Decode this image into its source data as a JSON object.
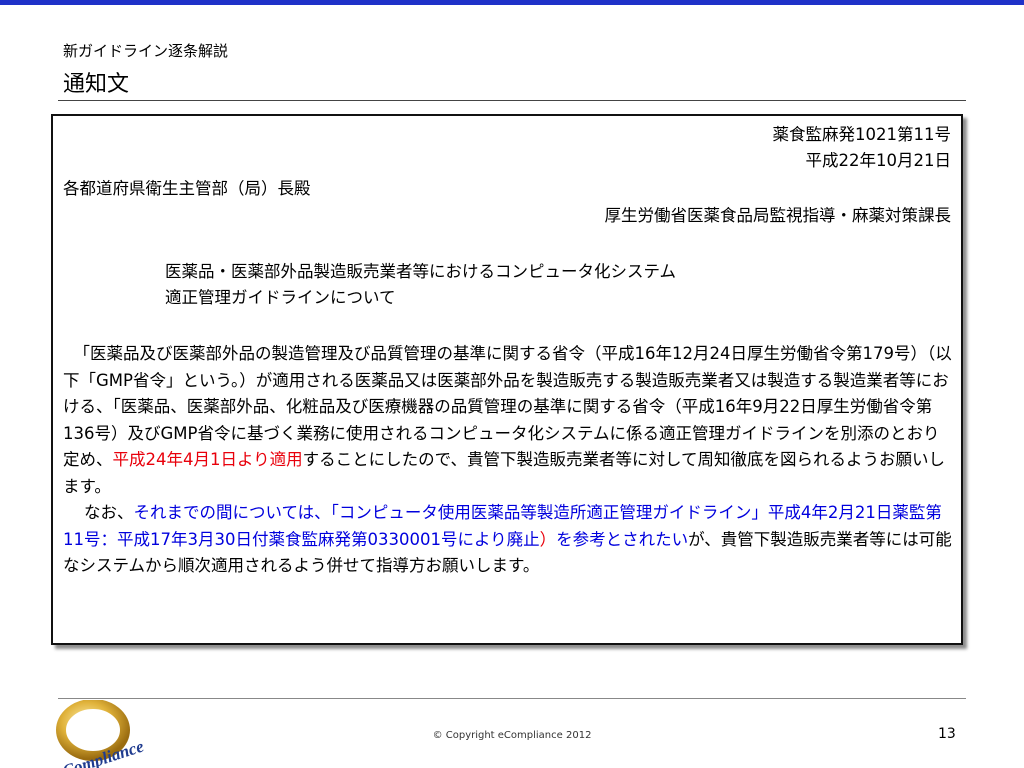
{
  "header": {
    "subtitle": "新ガイドライン逐条解説",
    "title": "通知文"
  },
  "document": {
    "doc_number": "薬食監麻発1021第11号",
    "date": "平成22年10月21日",
    "addressee": "各都道府県衛生主管部（局）長殿",
    "sender": "厚生労働省医薬食品局監視指導・麻薬対策課長",
    "subject_line1": "医薬品・医薬部外品製造販売業者等におけるコンピュータ化システム",
    "subject_line2": "適正管理ガイドラインについて",
    "body1_a": "「医薬品及び医薬部外品の製造管理及び品質管理の基準に関する省令（平成16年12月24日厚生労働省令第179号）（以下「GMP省令」という。）が適用される医薬品又は医薬部外品を製造販売する製造販売業者又は製造する製造業者等における、「医薬品、医薬部外品、化粧品及び医療機器の品質管理の基準に関する省令（平成16年9月22日厚生労働省令第136号）及びGMP省令に基づく業務に使用されるコンピュータ化システムに係る適正管理ガイドラインを別添のとおり定め、",
    "body1_red": "平成24年4月1日より適用",
    "body1_b": "することにしたので、貴管下製造販売業者等に対して周知徹底を図られるようお願いします。",
    "body2_a": "なお、",
    "body2_blue": "それまでの間については、「コンピュータ使用医薬品等製造所適正管理ガイドライン」平成4年2月21日薬監第11号：平成17年3月30日付薬食監麻発第0330001号により廃止",
    "body2_red": "）",
    "body2_blue2": "を参考とされたい",
    "body2_b": "が、貴管下製造販売業者等には可能なシステムから順次適用されるよう併せて指導方お願いします。"
  },
  "footer": {
    "logo_text": "eCompliance",
    "copyright": "© Copyright eCompliance 2012",
    "page_number": "13"
  }
}
